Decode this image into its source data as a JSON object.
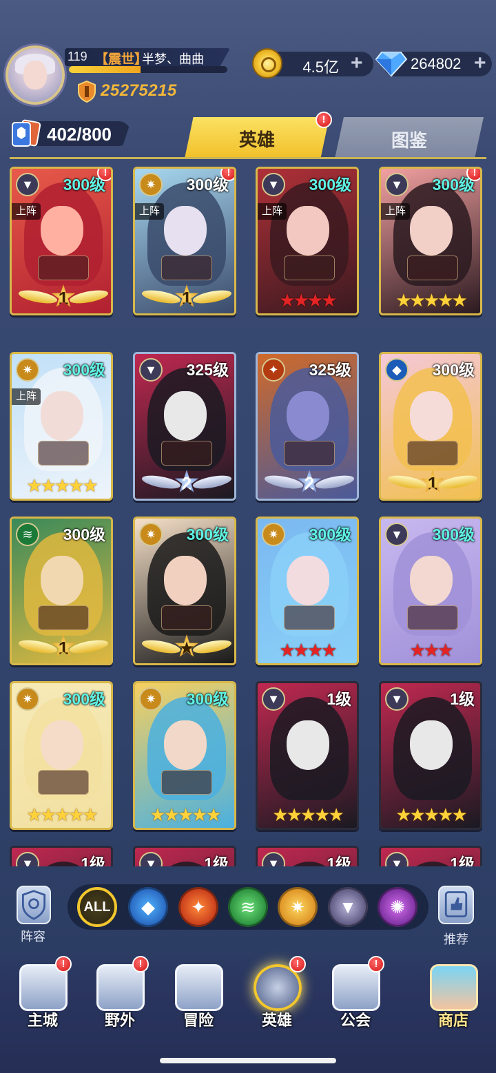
{
  "player": {
    "level": "119",
    "title_tag": "【震世】",
    "name": "半梦、曲曲",
    "exp_progress": 0.45,
    "power": "25275215"
  },
  "resources": {
    "gold": "4.5亿",
    "gems": "264802",
    "plus": "+"
  },
  "card_count": "402/800",
  "tabs": [
    {
      "label": "英雄",
      "active": true,
      "alert": "!"
    },
    {
      "label": "图鉴",
      "active": false
    }
  ],
  "heroes": [
    {
      "level": "300级",
      "faction": "dark",
      "deployed": "上阵",
      "badge": "1",
      "alert": "!"
    },
    {
      "level": "300级",
      "faction": "light",
      "deployed": "上阵",
      "badge": "1",
      "alert": "!"
    },
    {
      "level": "300级",
      "faction": "dark",
      "deployed": "上阵",
      "stars": "★★★★",
      "star_color": "red"
    },
    {
      "level": "300级",
      "faction": "dark",
      "deployed": "上阵",
      "stars": "★★★★★",
      "star_color": "gold",
      "alert": "!"
    },
    {
      "level": "300级",
      "faction": "light",
      "deployed": "上阵",
      "stars": "★★★★★",
      "star_color": "gold"
    },
    {
      "level": "325级",
      "faction": "dark",
      "badge": "2"
    },
    {
      "level": "325级",
      "faction": "fire",
      "badge": "2"
    },
    {
      "level": "300级",
      "faction": "water",
      "badge": "1"
    },
    {
      "level": "300级",
      "faction": "wind",
      "badge": "1"
    },
    {
      "level": "300级",
      "faction": "light",
      "badge": "★"
    },
    {
      "level": "300级",
      "faction": "light",
      "stars": "★★★★",
      "star_color": "red"
    },
    {
      "level": "300级",
      "faction": "dark",
      "stars": "★★★",
      "star_color": "red"
    },
    {
      "level": "300级",
      "faction": "light",
      "stars": "★★★★★",
      "star_color": "gold"
    },
    {
      "level": "300级",
      "faction": "light",
      "stars": "★★★★★",
      "star_color": "gold"
    },
    {
      "level": "1级",
      "faction": "dark",
      "stars": "★★★★★",
      "star_color": "gold"
    },
    {
      "level": "1级",
      "faction": "dark",
      "stars": "★★★★★",
      "star_color": "gold"
    },
    {
      "level": "1级",
      "faction": "dark"
    },
    {
      "level": "1级",
      "faction": "dark"
    },
    {
      "level": "1级",
      "faction": "dark"
    },
    {
      "level": "1级",
      "faction": "dark"
    }
  ],
  "filters": [
    {
      "label": "ALL",
      "icon": "all-filter-icon"
    },
    {
      "icon": "water-faction-icon"
    },
    {
      "icon": "fire-faction-icon"
    },
    {
      "icon": "wind-faction-icon"
    },
    {
      "icon": "light-faction-icon"
    },
    {
      "icon": "dark-faction-icon"
    },
    {
      "icon": "chaos-faction-icon"
    }
  ],
  "side_buttons": {
    "lineup": "阵容",
    "recommend": "推荐"
  },
  "nav": [
    {
      "label": "主城",
      "alert": "!"
    },
    {
      "label": "野外",
      "alert": "!"
    },
    {
      "label": "冒险"
    },
    {
      "label": "英雄",
      "alert": "!",
      "active": true
    },
    {
      "label": "公会",
      "alert": "!"
    },
    {
      "label": "商店"
    }
  ],
  "colors": {
    "accent_gold": "#f2c72e",
    "power_text": "#f4b83a",
    "level_highlight": "#5ff2e4",
    "alert_red": "#d41414"
  }
}
